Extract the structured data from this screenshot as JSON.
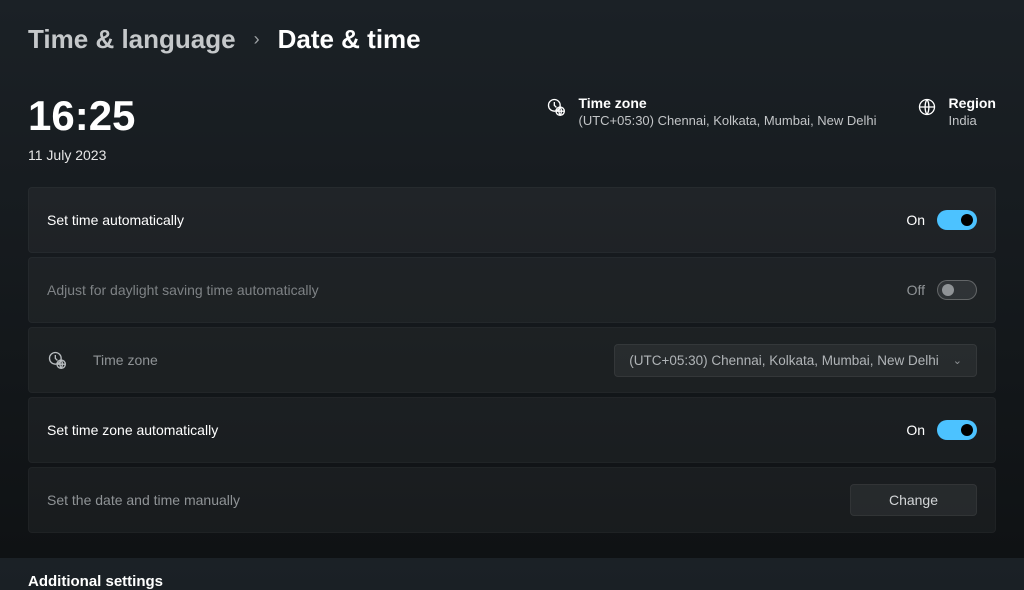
{
  "breadcrumb": {
    "parent": "Time & language",
    "current": "Date & time"
  },
  "hero": {
    "time": "16:25",
    "date": "11 July 2023",
    "timezone_label": "Time zone",
    "timezone_value": "(UTC+05:30) Chennai, Kolkata, Mumbai, New Delhi",
    "region_label": "Region",
    "region_value": "India"
  },
  "cards": {
    "auto_time": {
      "label": "Set time automatically",
      "state_text": "On"
    },
    "dst": {
      "label": "Adjust for daylight saving time automatically",
      "state_text": "Off"
    },
    "timezone": {
      "label": "Time zone",
      "select_text": "(UTC+05:30) Chennai, Kolkata, Mumbai, New Delhi"
    },
    "auto_tz": {
      "label": "Set time zone automatically",
      "state_text": "On"
    },
    "manual": {
      "label": "Set the date and time manually",
      "button": "Change"
    }
  },
  "section_heading": "Additional settings"
}
